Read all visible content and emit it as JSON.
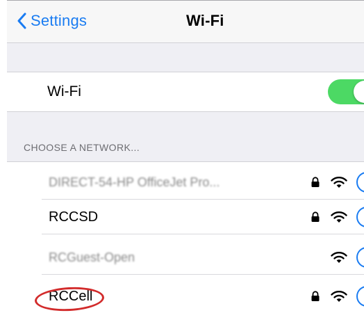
{
  "navbar": {
    "back_label": "Settings",
    "title": "Wi-Fi"
  },
  "wifi_toggle": {
    "label": "Wi-Fi",
    "state": "on",
    "color": "#4cd964"
  },
  "networks_section": {
    "header": "CHOOSE A NETWORK...",
    "networks": [
      {
        "name": "DIRECT-54-HP OfficeJet Pro...",
        "blurred": true,
        "secured": true
      },
      {
        "name": "RCCSD",
        "blurred": false,
        "secured": true
      },
      {
        "name": "RCGuest-Open",
        "blurred": true,
        "secured": false
      },
      {
        "name": "RCCell",
        "blurred": false,
        "secured": true,
        "highlighted": true
      }
    ]
  },
  "colors": {
    "accent": "#1a7cf2",
    "highlight": "#d22b2b",
    "background": "#efeff4"
  },
  "icons": {
    "back": "chevron-left-icon",
    "lock": "lock-icon",
    "wifi": "wifi-signal-icon",
    "info": "info-icon"
  }
}
